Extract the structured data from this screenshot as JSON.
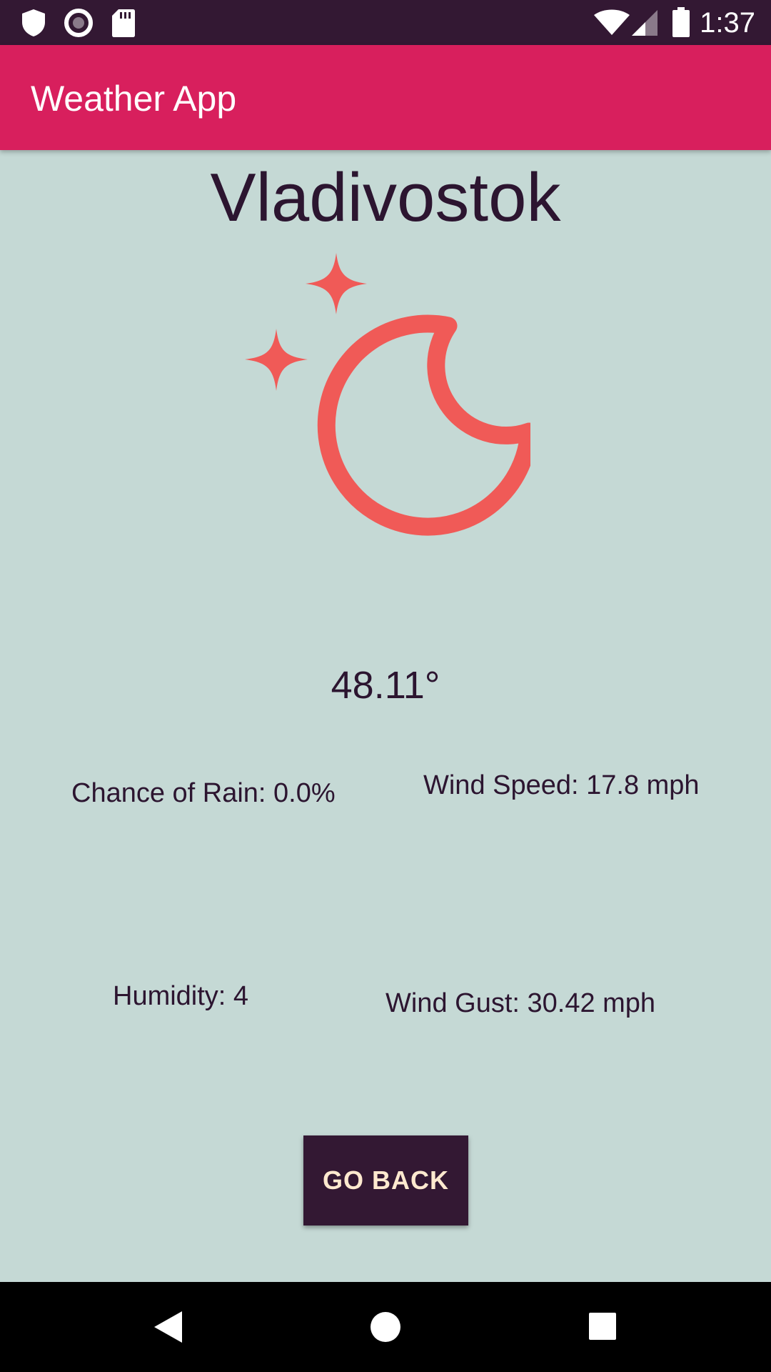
{
  "status_bar": {
    "time": "1:37",
    "left_icons": [
      "shield-icon",
      "record-icon",
      "sd-card-icon"
    ],
    "right_icons": [
      "wifi-icon",
      "cell-signal-icon",
      "battery-icon"
    ]
  },
  "app_bar": {
    "title": "Weather App",
    "color": "#d81f5d"
  },
  "weather": {
    "city": "Vladivostok",
    "condition_icon": "clear-night-moon-stars-icon",
    "icon_color": "#f05a57",
    "temperature": "48.11°",
    "chance_of_rain": "Chance of Rain: 0.0%",
    "wind_speed": "Wind Speed: 17.8 mph",
    "humidity": "Humidity: 4",
    "wind_gust": "Wind Gust: 30.42 mph"
  },
  "actions": {
    "go_back_label": "GO BACK"
  },
  "nav_bar": {
    "buttons": [
      "back-icon",
      "home-icon",
      "recents-icon"
    ]
  },
  "colors": {
    "background": "#c5d9d5",
    "status_bar": "#331833",
    "text": "#2c1530",
    "button_bg": "#331833",
    "button_text": "#ffe9cf"
  }
}
